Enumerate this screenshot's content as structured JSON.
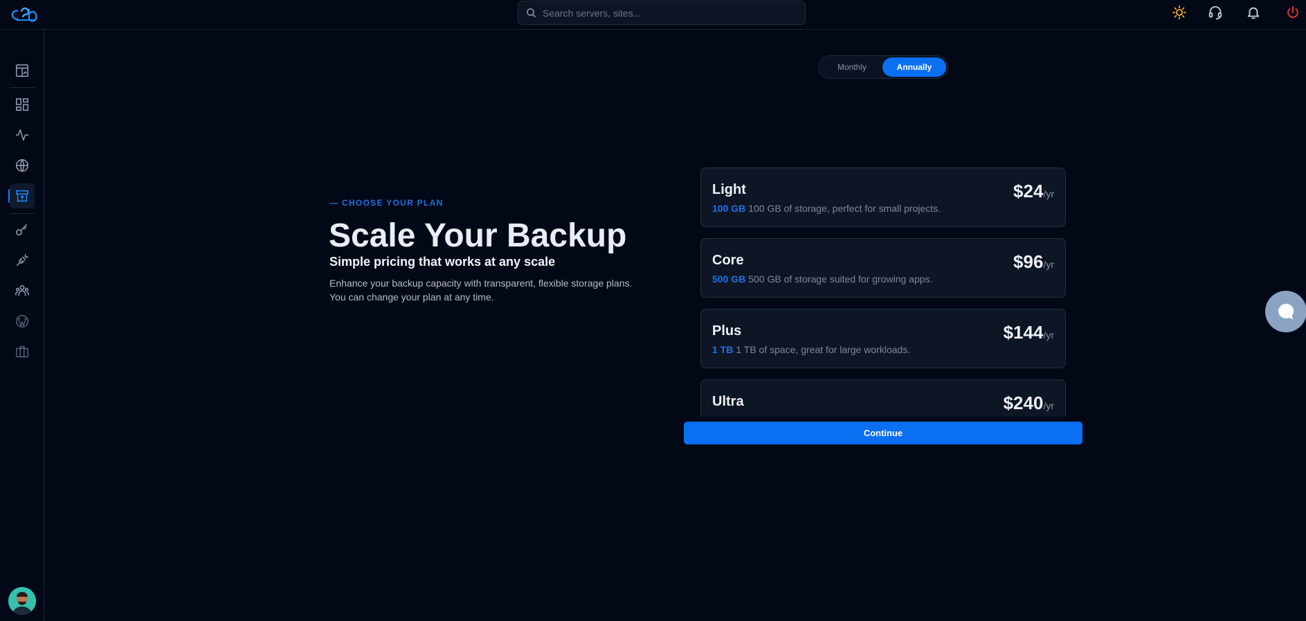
{
  "search": {
    "placeholder": "Search servers, sites..."
  },
  "billing": {
    "monthly_label": "Monthly",
    "annually_label": "Annually",
    "selected": "Annually"
  },
  "hero": {
    "eyebrow": "— CHOOSE YOUR PLAN",
    "title": "Scale Your Backup",
    "subtitle": "Simple pricing that works at any scale",
    "description": "Enhance your backup capacity with transparent, flexible storage plans. You can change your plan at any time."
  },
  "plans": [
    {
      "name": "Light",
      "size": "100 GB",
      "desc": "100 GB of storage, perfect for small projects.",
      "price": "$24",
      "period": "/yr"
    },
    {
      "name": "Core",
      "size": "500 GB",
      "desc": "500 GB of storage suited for growing apps.",
      "price": "$96",
      "period": "/yr"
    },
    {
      "name": "Plus",
      "size": "1 TB",
      "desc": "1 TB of space, great for large workloads.",
      "price": "$144",
      "period": "/yr"
    },
    {
      "name": "Ultra",
      "size": "",
      "desc": "",
      "price": "$240",
      "period": "/yr"
    }
  ],
  "continue_label": "Continue",
  "colors": {
    "accent": "#0a6ff0",
    "accent_text": "#1a73e8",
    "background": "#030817",
    "power": "#e0342f",
    "sun": "#f5a623"
  },
  "icons": {
    "top": [
      "sun-icon",
      "headset-icon",
      "bell-icon",
      "power-icon"
    ],
    "sidebar": [
      "dashboard-chart-icon",
      "grid-icon",
      "activity-icon",
      "globe-icon",
      "backup-archive-icon",
      "key-icon",
      "plug-icon",
      "team-icon",
      "wordpress-icon",
      "briefcase-icon"
    ]
  }
}
